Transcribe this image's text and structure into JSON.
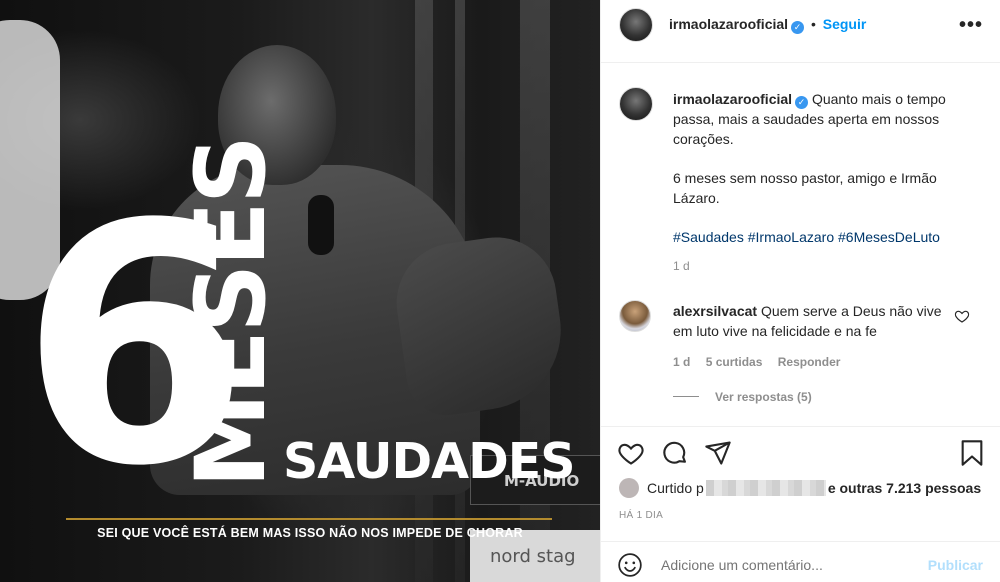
{
  "post_image": {
    "big_number": "6",
    "vertical_word": "MESES",
    "horizontal_word": "SAUDADES",
    "tagline": "SEI QUE VOCÊ ESTÁ BEM MAS ISSO NÃO NOS IMPEDE DE CHORAR",
    "keyboard_brand": "M-AUDIO",
    "keyboard_brand2": "nord stag",
    "accent_color": "#b38b2e"
  },
  "header": {
    "username": "irmaolazarooficial",
    "separator": "•",
    "follow_label": "Seguir",
    "more_label": "•••"
  },
  "caption": {
    "username": "irmaolazarooficial",
    "line1": "Quanto mais o tempo passa, mais a saudades aperta em nossos corações.",
    "line2": "6 meses sem nosso pastor, amigo e Irmão Lázaro.",
    "hashtags": "#Saudades #IrmaoLazaro #6MesesDeLuto",
    "time": "1 d"
  },
  "comment": {
    "username": "alexrsilvacat",
    "text": "Quem serve a Deus não vive em luto vive na felicidade e na fe",
    "time": "1 d",
    "likes": "5 curtidas",
    "reply_label": "Responder",
    "view_replies": "Ver respostas (5)"
  },
  "likes": {
    "prefix": "Curtido p",
    "suffix": "e outras 7.213 pessoas"
  },
  "post_time": "HÁ 1 DIA",
  "add_comment": {
    "placeholder": "Adicione um comentário...",
    "publish_label": "Publicar"
  },
  "colors": {
    "link_blue": "#0095f6",
    "hashtag": "#00376b",
    "muted": "#8e8e8e",
    "verified": "#3897f0"
  }
}
